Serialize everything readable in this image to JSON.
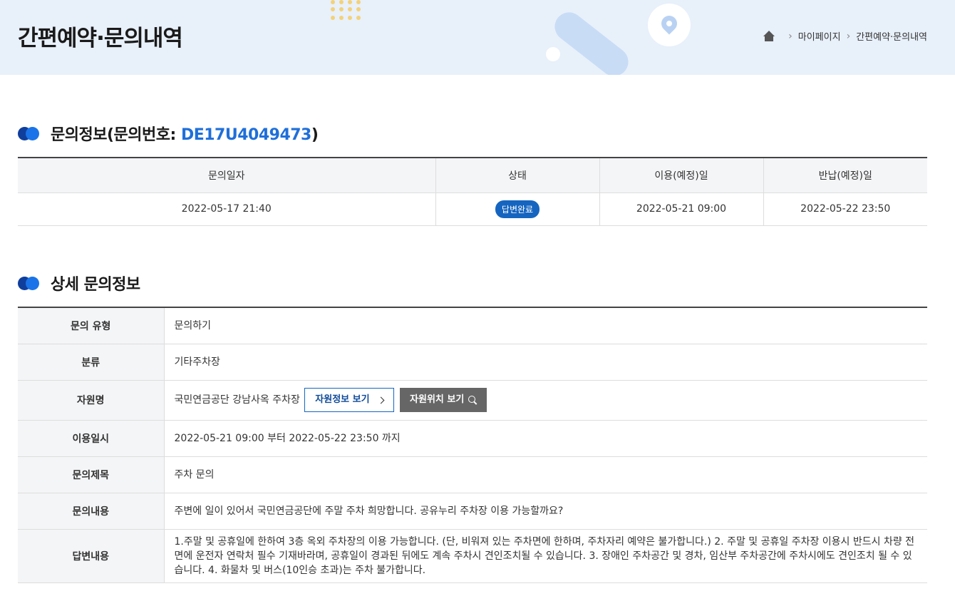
{
  "page": {
    "title": "간편예약·문의내역"
  },
  "breadcrumb": {
    "home_icon": "home-icon",
    "items": [
      "마이페이지",
      "간편예약·문의내역"
    ]
  },
  "inquiry_info": {
    "title_prefix": "문의정보(문의번호: ",
    "number": "DE17U4049473",
    "title_suffix": ")",
    "columns": [
      "문의일자",
      "상태",
      "이용(예정)일",
      "반납(예정)일"
    ],
    "row": {
      "date": "2022-05-17 21:40",
      "status": "답변완료",
      "use_date": "2022-05-21 09:00",
      "return_date": "2022-05-22 23:50"
    }
  },
  "detail": {
    "title": "상세 문의정보",
    "rows": [
      {
        "label": "문의 유형",
        "value": "문의하기"
      },
      {
        "label": "분류",
        "value": "기타주차장"
      },
      {
        "label": "자원명",
        "value": "국민연금공단 강남사옥 주차장"
      },
      {
        "label": "이용일시",
        "value": "2022-05-21 09:00 부터 2022-05-22 23:50 까지"
      },
      {
        "label": "문의제목",
        "value": "주차 문의"
      },
      {
        "label": "문의내용",
        "value": "주변에 일이 있어서 국민연금공단에 주말 주차 희망합니다. 공유누리 주차장 이용 가능할까요?"
      },
      {
        "label": "답변내용",
        "value": "1.주말 및 공휴일에 한하여 3층 옥외 주차장의 이용 가능합니다. (단, 비워져 있는 주차면에 한하며, 주차자리 예약은 불가합니다.) 2. 주말 및 공휴일 주차장 이용시 반드시 차량 전면에 운전자 연락처 필수 기재바라며, 공휴일이 경과된 뒤에도 계속 주차시 견인조치될 수 있습니다. 3. 장애인 주차공간 및 경차, 임산부 주차공간에 주차시에도 견인조치 될 수 있습니다. 4. 화물차 및 버스(10인승 초과)는 주차 불가합니다."
      }
    ],
    "btn_resource_info": "자원정보 보기",
    "btn_resource_location": "자원위치 보기"
  },
  "colors": {
    "accent_blue": "#1f6fd9",
    "badge_blue": "#1565c0",
    "header_bg": "#e8f0fa"
  }
}
